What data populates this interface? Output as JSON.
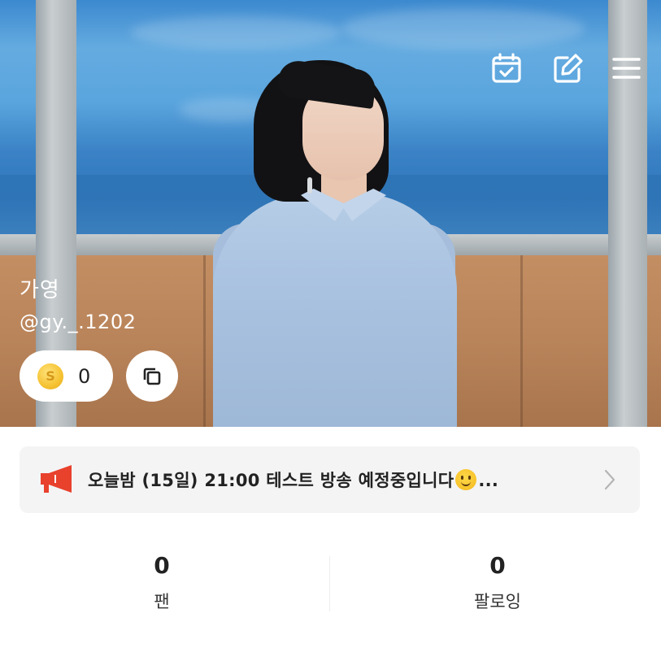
{
  "header": {
    "icons": [
      "calendar-check-icon",
      "edit-icon",
      "menu-icon"
    ]
  },
  "profile": {
    "name": "가영",
    "handle": "@gy._.1202",
    "coin_symbol": "S",
    "coin_count": "0"
  },
  "notice": {
    "icon": "megaphone-icon",
    "text": "오늘밤 (15일) 21:00 테스트 방송 예정중입니다",
    "trailing": "...",
    "accent": "#e8412c"
  },
  "stats": {
    "fans": {
      "value": "0",
      "label": "팬"
    },
    "following": {
      "value": "0",
      "label": "팔로잉"
    }
  }
}
